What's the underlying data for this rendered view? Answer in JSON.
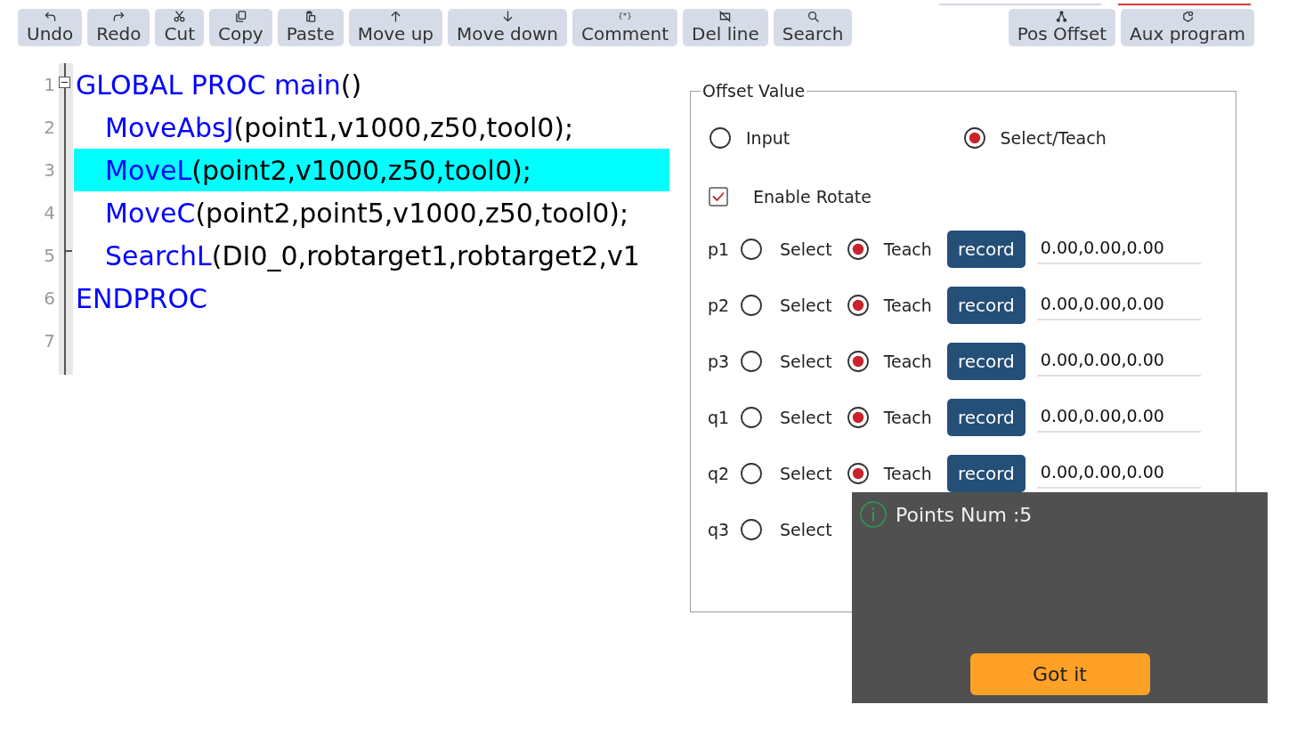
{
  "toolbar": {
    "left_buttons": [
      {
        "kind": "undo",
        "label": "Undo"
      },
      {
        "kind": "redo",
        "label": "Redo"
      },
      {
        "kind": "cut",
        "label": "Cut"
      },
      {
        "kind": "copy",
        "label": "Copy"
      },
      {
        "kind": "paste",
        "label": "Paste"
      },
      {
        "kind": "move-up",
        "label": "Move up"
      },
      {
        "kind": "move-down",
        "label": "Move down"
      },
      {
        "kind": "comment",
        "glyph": "{*}",
        "label": "Comment"
      },
      {
        "kind": "delete-line",
        "label": "Del line"
      },
      {
        "kind": "search",
        "label": "Search"
      }
    ],
    "right_buttons": [
      {
        "kind": "pos-offset",
        "label": "Pos Offset"
      },
      {
        "kind": "aux-program",
        "label": "Aux program"
      }
    ]
  },
  "editor": {
    "lines": [
      {
        "number": "1",
        "selected": false,
        "tokens": [
          {
            "kind": "keyword",
            "text": "GLOBAL PROC main"
          },
          {
            "kind": "plain",
            "text": "()"
          }
        ],
        "children": [
          {
            "number": "2",
            "selected": false,
            "tokens": [
              {
                "kind": "keyword",
                "text": "MoveAbsJ"
              },
              {
                "kind": "plain",
                "text": "(point1,v1000,z50,tool0);"
              }
            ]
          },
          {
            "number": "3",
            "selected": true,
            "tokens": [
              {
                "kind": "keyword",
                "text": "MoveL"
              },
              {
                "kind": "plain",
                "text": "(point2,v1000,z50,tool0);"
              }
            ]
          },
          {
            "number": "4",
            "selected": false,
            "tokens": [
              {
                "kind": "keyword",
                "text": "MoveC"
              },
              {
                "kind": "plain",
                "text": "(point2,point5,v1000,z50,tool0);"
              }
            ]
          },
          {
            "number": "5",
            "selected": false,
            "tokens": [
              {
                "kind": "keyword",
                "text": "SearchL"
              },
              {
                "kind": "plain",
                "text": "(DI0_0,robtarget1,robtarget2,v1"
              }
            ]
          }
        ]
      },
      {
        "number": "6",
        "selected": false,
        "tokens": [
          {
            "kind": "keyword",
            "text": "ENDPROC"
          }
        ]
      },
      {
        "number": "7",
        "selected": false
      }
    ]
  },
  "offset_panel": {
    "title": "Offset Value",
    "modes": [
      {
        "label": "Input",
        "selected": false
      },
      {
        "label": "Select/Teach",
        "selected": true
      }
    ],
    "enable_rotate": {
      "label": "Enable Rotate",
      "checked": true
    },
    "points": [
      {
        "name": "p1",
        "select": {
          "label": "Select",
          "selected": false
        },
        "teach": {
          "label": "Teach",
          "selected": true
        },
        "record_button": "record",
        "value": "0.00,0.00,0.00"
      },
      {
        "name": "p2",
        "select": {
          "label": "Select",
          "selected": false
        },
        "teach": {
          "label": "Teach",
          "selected": true
        },
        "record_button": "record",
        "value": "0.00,0.00,0.00"
      },
      {
        "name": "p3",
        "select": {
          "label": "Select",
          "selected": false
        },
        "teach": {
          "label": "Teach",
          "selected": true
        },
        "record_button": "record",
        "value": "0.00,0.00,0.00"
      },
      {
        "name": "q1",
        "select": {
          "label": "Select",
          "selected": false
        },
        "teach": {
          "label": "Teach",
          "selected": true
        },
        "record_button": "record",
        "value": "0.00,0.00,0.00"
      },
      {
        "name": "q2",
        "select": {
          "label": "Select",
          "selected": false
        },
        "teach": {
          "label": "Teach",
          "selected": true
        },
        "record_button": "record",
        "value": "0.00,0.00,0.00"
      },
      {
        "name": "q3",
        "select": {
          "label": "Select",
          "selected": false
        }
      }
    ]
  },
  "popup": {
    "message": "Points Num :5",
    "button": "Got it"
  }
}
